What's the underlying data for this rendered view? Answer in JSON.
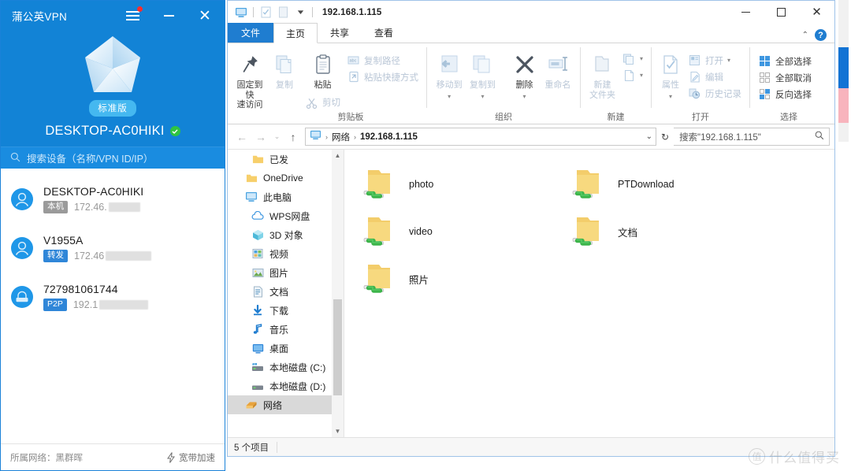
{
  "vpn": {
    "title": "蒲公英VPN",
    "controls": {
      "menu": "menu-icon",
      "minimize": "–",
      "close": "✕"
    },
    "edition_badge": "标准版",
    "device_name": "DESKTOP-AC0HIKI",
    "search_placeholder": "搜索设备（名称/VPN ID/IP）",
    "devices": [
      {
        "name": "DESKTOP-AC0HIKI",
        "tag": "本机",
        "tag_type": "local",
        "ip": "172.46.",
        "icon": "user-avatar-icon"
      },
      {
        "name": "V1955A",
        "tag": "转发",
        "tag_type": "forward",
        "ip": "172.46",
        "icon": "user-avatar-icon"
      },
      {
        "name": "727981061744",
        "tag": "P2P",
        "tag_type": "p2p",
        "ip": "192.1",
        "icon": "router-icon"
      }
    ],
    "footer": {
      "network_label": "所属网络：黑群晖",
      "accelerate": "宽带加速"
    }
  },
  "explorer": {
    "window_title": "192.168.1.115",
    "quick_access": [
      "computer-icon",
      "properties-icon",
      "new-folder-icon",
      "customize-caret-icon"
    ],
    "window_controls": {
      "minimize": "–",
      "maximize": "□",
      "close": "✕"
    },
    "tabs": [
      {
        "label": "文件",
        "type": "file"
      },
      {
        "label": "主页",
        "type": "active"
      },
      {
        "label": "共享",
        "type": "normal"
      },
      {
        "label": "查看",
        "type": "normal"
      }
    ],
    "tab_right": {
      "collapse": "⌃",
      "help": "?"
    },
    "ribbon": {
      "groups": [
        {
          "name": "剪贴板",
          "big": [
            {
              "label": "固定到快\n速访问",
              "icon": "pin-icon",
              "dim": false
            },
            {
              "label": "复制",
              "icon": "copy-icon",
              "dim": true
            },
            {
              "label": "粘贴",
              "icon": "paste-icon",
              "dim": false
            }
          ],
          "small": [
            {
              "label": "复制路径",
              "icon": "copy-path-icon",
              "dim": true
            },
            {
              "label": "粘贴快捷方式",
              "icon": "paste-shortcut-icon",
              "dim": true
            },
            {
              "label": "剪切",
              "icon": "cut-icon",
              "dim": true
            }
          ]
        },
        {
          "name": "组织",
          "big": [
            {
              "label": "移动到",
              "icon": "move-to-icon",
              "dim": true
            },
            {
              "label": "复制到",
              "icon": "copy-to-icon",
              "dim": true
            },
            {
              "label": "删除",
              "icon": "delete-icon",
              "dim": false
            },
            {
              "label": "重命名",
              "icon": "rename-icon",
              "dim": true
            }
          ],
          "small": []
        },
        {
          "name": "新建",
          "big": [
            {
              "label": "新建\n文件夹",
              "icon": "new-folder-icon",
              "dim": true
            }
          ],
          "small": [
            {
              "label": "",
              "icon": "new-item-icon",
              "dim": true
            },
            {
              "label": "",
              "icon": "easy-access-icon",
              "dim": true
            }
          ]
        },
        {
          "name": "打开",
          "big": [
            {
              "label": "属性",
              "icon": "properties-icon",
              "dim": true
            }
          ],
          "small": [
            {
              "label": "打开",
              "icon": "open-icon",
              "dim": true
            },
            {
              "label": "编辑",
              "icon": "edit-icon",
              "dim": true
            },
            {
              "label": "历史记录",
              "icon": "history-icon",
              "dim": true
            }
          ]
        },
        {
          "name": "选择",
          "big": [],
          "small": [
            {
              "label": "全部选择",
              "icon": "select-all-icon",
              "dim": false
            },
            {
              "label": "全部取消",
              "icon": "select-none-icon",
              "dim": false
            },
            {
              "label": "反向选择",
              "icon": "invert-selection-icon",
              "dim": false
            }
          ]
        }
      ]
    },
    "address_bar": {
      "back": "←",
      "forward": "→",
      "recent": "⌄",
      "up": "↑",
      "crumbs": [
        "网络",
        "192.168.1.115"
      ],
      "dropdown": "⌄",
      "refresh": "↻",
      "search_text": "搜索\"192.168.1.115\""
    },
    "nav_tree": [
      {
        "label": "已发",
        "icon": "folder-icon",
        "level": 2,
        "selected": false
      },
      {
        "label": "OneDrive",
        "icon": "folder-icon",
        "level": 1,
        "selected": false
      },
      {
        "label": "此电脑",
        "icon": "computer-icon",
        "level": 1,
        "selected": false
      },
      {
        "label": "WPS网盘",
        "icon": "cloud-icon",
        "level": 2,
        "selected": false
      },
      {
        "label": "3D 对象",
        "icon": "3d-objects-icon",
        "level": 2,
        "selected": false
      },
      {
        "label": "视频",
        "icon": "videos-icon",
        "level": 2,
        "selected": false
      },
      {
        "label": "图片",
        "icon": "pictures-icon",
        "level": 2,
        "selected": false
      },
      {
        "label": "文档",
        "icon": "documents-icon",
        "level": 2,
        "selected": false
      },
      {
        "label": "下载",
        "icon": "downloads-icon",
        "level": 2,
        "selected": false
      },
      {
        "label": "音乐",
        "icon": "music-icon",
        "level": 2,
        "selected": false
      },
      {
        "label": "桌面",
        "icon": "desktop-icon",
        "level": 2,
        "selected": false
      },
      {
        "label": "本地磁盘 (C:)",
        "icon": "system-drive-icon",
        "level": 2,
        "selected": false
      },
      {
        "label": "本地磁盘 (D:)",
        "icon": "drive-icon",
        "level": 2,
        "selected": false
      },
      {
        "label": "网络",
        "icon": "network-icon",
        "level": 1,
        "selected": true
      }
    ],
    "folders": [
      {
        "name": "photo",
        "icon": "shared-folder-icon"
      },
      {
        "name": "PTDownload",
        "icon": "shared-folder-icon"
      },
      {
        "name": "video",
        "icon": "shared-folder-icon"
      },
      {
        "name": "文档",
        "icon": "shared-folder-icon"
      },
      {
        "name": "照片",
        "icon": "shared-folder-icon"
      }
    ],
    "status": {
      "item_count": "5 个项目"
    }
  },
  "watermark": {
    "mark": "值",
    "text": "什么值得买"
  },
  "colors": {
    "vpn_blue": "#1283d6",
    "vpn_search_blue": "#1a8ce0",
    "explorer_accent": "#1f7dd0",
    "folder_yellow": "#f6ce67",
    "share_green": "#3cb44a",
    "online_green": "#2fc442",
    "tag_gray": "#9a9a9a",
    "tag_blue": "#2f86d8"
  }
}
